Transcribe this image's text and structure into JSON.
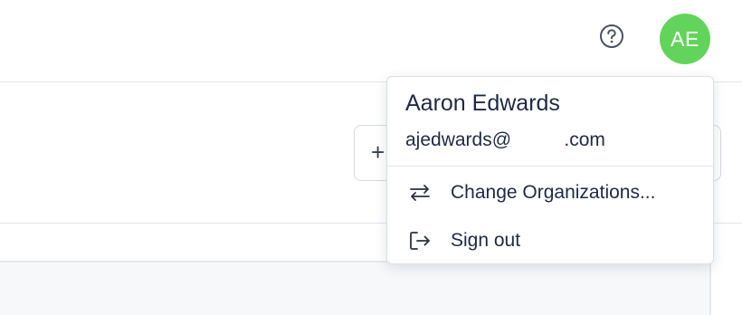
{
  "header": {
    "help_icon": "question-circle-icon",
    "avatar_initials": "AE",
    "avatar_color": "#63d45b"
  },
  "user_menu": {
    "name": "Aaron Edwards",
    "email": "ajedwards@          .com",
    "items": [
      {
        "label": "Change Organizations...",
        "icon": "switch-arrows-icon"
      },
      {
        "label": "Sign out",
        "icon": "sign-out-icon"
      }
    ]
  },
  "background": {
    "button_icon": "plus-icon",
    "button_symbol": "+"
  }
}
